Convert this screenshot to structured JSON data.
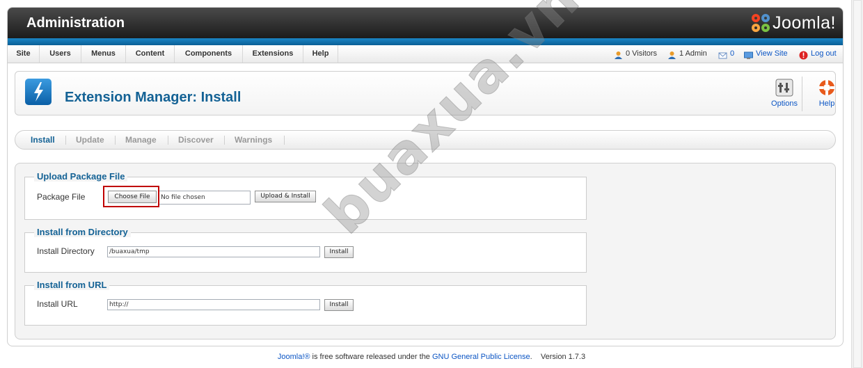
{
  "header": {
    "title": "Administration",
    "logo_text": "Joomla!"
  },
  "menu": {
    "items": [
      "Site",
      "Users",
      "Menus",
      "Content",
      "Components",
      "Extensions",
      "Help"
    ],
    "status": {
      "visitors": "0 Visitors",
      "admins": "1 Admin",
      "messages": "0",
      "view_site": "View Site",
      "logout": "Log out"
    }
  },
  "toolbar": {
    "page_title": "Extension Manager: Install",
    "options_label": "Options",
    "help_label": "Help"
  },
  "submenu": {
    "items": [
      "Install",
      "Update",
      "Manage",
      "Discover",
      "Warnings"
    ],
    "active": "Install"
  },
  "upload": {
    "legend": "Upload Package File",
    "label": "Package File",
    "choose_button": "Choose File",
    "file_status": "No file chosen",
    "submit_button": "Upload & Install"
  },
  "directory": {
    "legend": "Install from Directory",
    "label": "Install Directory",
    "value": "/buaxua/tmp",
    "submit_button": "Install"
  },
  "url": {
    "legend": "Install from URL",
    "label": "Install URL",
    "value": "http://",
    "submit_button": "Install"
  },
  "footer": {
    "brand": "Joomla!®",
    "text": " is free software released under the ",
    "license": "GNU General Public License",
    "version": "Version 1.7.3"
  },
  "watermark": "buaxua.vn",
  "colors": {
    "header_dark": "#1c1c1c",
    "stripe_blue": "#0a5f96",
    "title_blue": "#146295",
    "link_blue": "#0b55c4",
    "highlight_red": "#c00000"
  }
}
